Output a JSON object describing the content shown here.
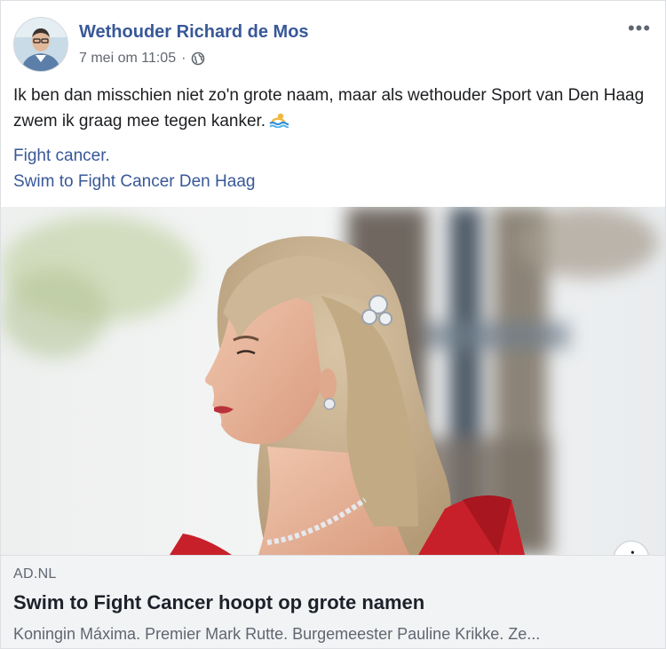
{
  "post": {
    "author": "Wethouder Richard de Mos",
    "date": "7 mei om 11:05",
    "separator": "·",
    "visibility_icon": "globe-icon",
    "more_label": "•••",
    "text": "Ik ben dan misschien niet zo'n grote naam, maar als wethouder Sport van Den Haag zwem ik graag mee tegen kanker.",
    "emoji_icon": "swimmer-emoji-icon",
    "link1": "Fight cancer",
    "link1_suffix": ".",
    "link2": "Swim to Fight Cancer Den Haag"
  },
  "preview": {
    "info_label": "i",
    "domain": "AD.NL",
    "title": "Swim to Fight Cancer hoopt op grote namen",
    "description": "Koningin Máxima. Premier Mark Rutte. Burgemeester Pauline Krikke. Ze..."
  },
  "colors": {
    "link_blue": "#385898",
    "meta_gray": "#616770",
    "preview_bg": "#f2f3f5",
    "dress_red": "#c8202a"
  }
}
